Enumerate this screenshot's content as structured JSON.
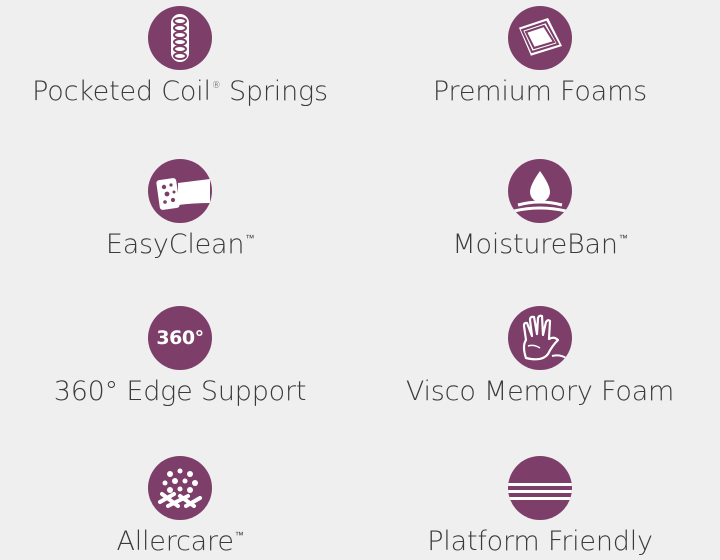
{
  "accent_color": "#7d3e6a",
  "features": [
    {
      "label": "Pocketed Coil",
      "mark": "®",
      "tail": " Springs",
      "icon": "coil-spring-icon"
    },
    {
      "label": "Premium Foams",
      "mark": "",
      "tail": "",
      "icon": "foam-layers-icon"
    },
    {
      "label": "EasyClean",
      "mark": "™",
      "tail": "",
      "icon": "sponge-icon"
    },
    {
      "label": "MoistureBan",
      "mark": "™",
      "tail": "",
      "icon": "water-drop-icon"
    },
    {
      "label": "360° Edge Support",
      "mark": "",
      "tail": "",
      "icon": "edge-360-icon",
      "icon_text": "360°"
    },
    {
      "label": "Visco Memory Foam",
      "mark": "",
      "tail": "",
      "icon": "hand-print-icon"
    },
    {
      "label": "Allercare",
      "mark": "™",
      "tail": "",
      "icon": "allergen-shield-icon"
    },
    {
      "label": "Platform Friendly",
      "mark": "",
      "tail": "",
      "icon": "platform-stripes-icon"
    }
  ]
}
